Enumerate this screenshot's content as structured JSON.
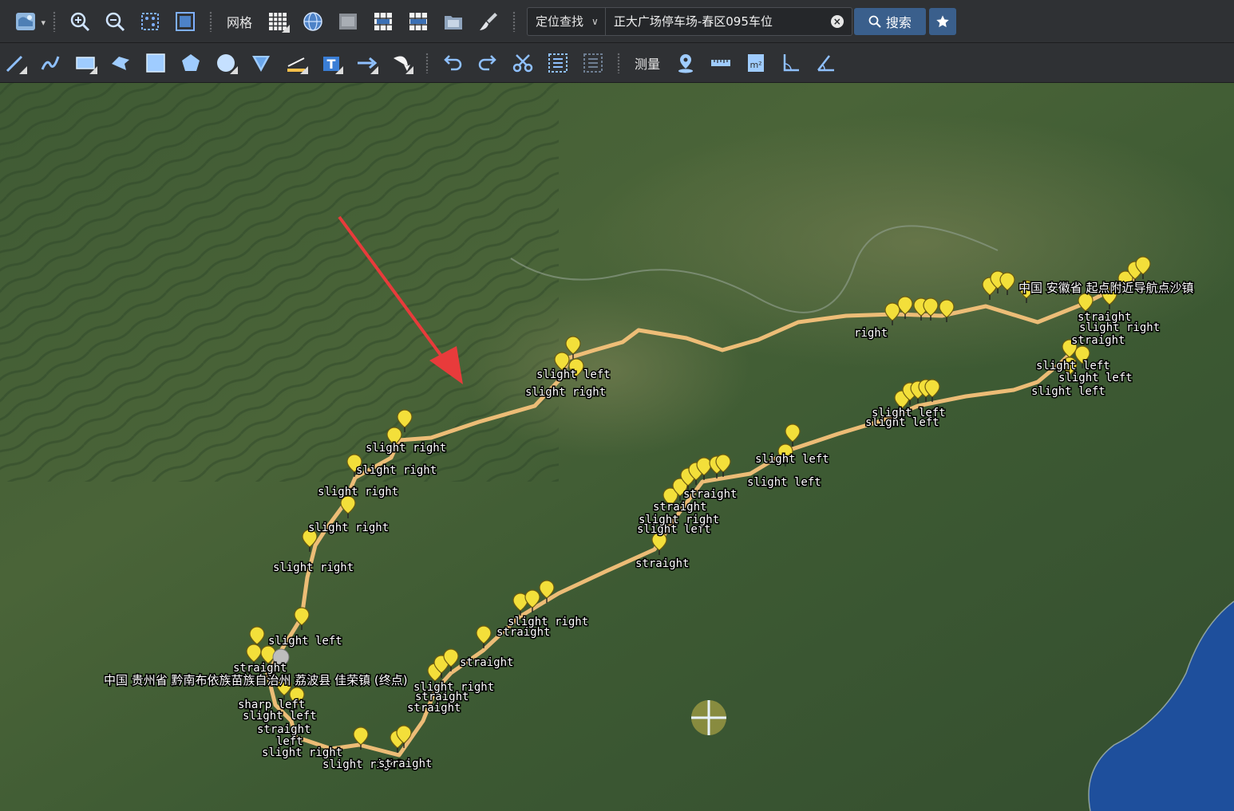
{
  "toolbar1": {
    "grid_label": "网格",
    "search": {
      "mode_label": "定位查找",
      "value": "正大广场停车场-春区095车位",
      "button_label": "搜索"
    },
    "icons": [
      "globe-layers-icon",
      "zoom-in-icon",
      "zoom-out-icon",
      "fit-extent-icon",
      "full-extent-icon",
      "grid-icon",
      "lng-globe-icon",
      "km-grid-icon",
      "nm-grid-icon",
      "mgrs-grid-icon",
      "image-overlay-icon",
      "brush-icon",
      "star-icon"
    ]
  },
  "toolbar2": {
    "measure_label": "测量",
    "icons": [
      "line-draw-icon",
      "curve-draw-icon",
      "rectangle-draw-icon",
      "freehand-polygon-icon",
      "square-draw-icon",
      "pentagon-draw-icon",
      "circle-draw-icon",
      "shield-draw-icon",
      "distance-label-icon",
      "text-label-icon",
      "arrow-draw-icon",
      "curved-arrow-icon",
      "undo-icon",
      "redo-icon",
      "cut-icon",
      "select-all-icon",
      "deselect-icon",
      "pin-measure-icon",
      "ruler-icon",
      "area-icon",
      "angle-icon",
      "bearing-icon"
    ]
  },
  "map": {
    "colors": {
      "route": "#f6c27a",
      "pin": "#f3df3a",
      "pin_stroke": "#6b5a10",
      "label": "#ffffff"
    },
    "start_label": "中国 安徽省 起点附近导航点沙镇",
    "end_label": "中国 贵州省 黔南布依族苗族自治州 荔波县 佳荣镇 (终点)",
    "turn_labels": [
      "slight left",
      "slight right",
      "straight",
      "sharp left",
      "left",
      "right",
      "slight right",
      "slight left",
      "straight",
      "slight right",
      "slight left",
      "straight",
      "slight right",
      "slight left",
      "straight",
      "slight right",
      "slight left",
      "straight",
      "slight right",
      "slight left",
      "straight",
      "slight right",
      "slight left",
      "straight",
      "slight right",
      "slight left",
      "straight",
      "slight right",
      "slight left",
      "straight",
      "slight right",
      "slight left",
      "straight",
      "slight right",
      "straight",
      "slight left",
      "slight right",
      "straight"
    ]
  }
}
